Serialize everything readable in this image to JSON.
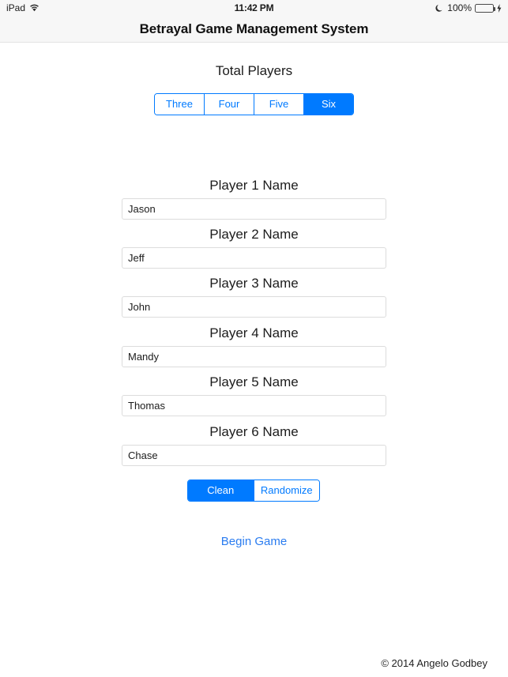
{
  "status_bar": {
    "carrier": "iPad",
    "wifi_icon": "wifi-icon",
    "time": "11:42 PM",
    "dnd_icon": "moon-icon",
    "battery_percent": "100%",
    "battery_icon": "battery-icon",
    "charging_icon": "lightning-bolt-icon",
    "battery_color": "#4cd964",
    "background_color": "#f7f7f7"
  },
  "nav_bar": {
    "title": "Betrayal Game Management System",
    "background_color": "#f7f7f7"
  },
  "main": {
    "total_players_heading": "Total Players",
    "accent_color": "#007aff",
    "player_count_options": [
      {
        "label": "Three",
        "selected": false
      },
      {
        "label": "Four",
        "selected": false
      },
      {
        "label": "Five",
        "selected": false
      },
      {
        "label": "Six",
        "selected": true
      }
    ],
    "players": [
      {
        "label": "Player 1 Name",
        "value": "Jason"
      },
      {
        "label": "Player 2 Name",
        "value": "Jeff"
      },
      {
        "label": "Player 3 Name",
        "value": "John"
      },
      {
        "label": "Player 4 Name",
        "value": "Mandy"
      },
      {
        "label": "Player 5 Name",
        "value": "Thomas"
      },
      {
        "label": "Player 6 Name",
        "value": "Chase"
      }
    ],
    "action_options": [
      {
        "label": "Clean",
        "selected": true
      },
      {
        "label": "Randomize",
        "selected": false
      }
    ],
    "begin_game_label": "Begin Game",
    "begin_game_color": "#2a7cf0"
  },
  "footer": {
    "copyright": "© 2014 Angelo Godbey"
  }
}
